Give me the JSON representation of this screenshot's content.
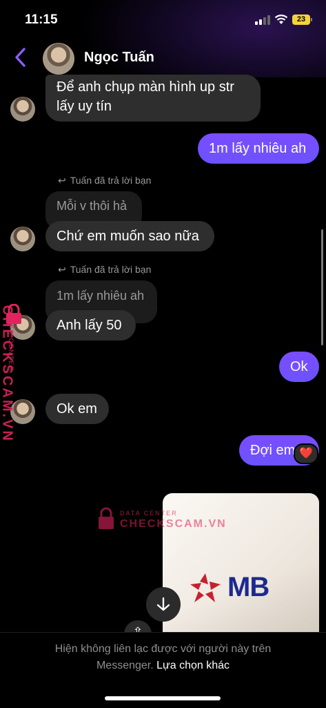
{
  "status_bar": {
    "time": "11:15",
    "battery": "23"
  },
  "header": {
    "contact_name": "Ngọc Tuấn"
  },
  "messages": {
    "m1": "Để anh chụp màn hình up str",
    "m1b": "lấy uy tín",
    "m2": "1m lấy nhiêu ah",
    "reply1_hint": "Tuấn đã trả lời bạn",
    "reply1_quoted": "Mỗi v thôi hả",
    "m3": "Chứ em muốn sao nữa",
    "reply2_hint": "Tuấn đã trả lời bạn",
    "reply2_quoted": "1m lấy nhiêu ah",
    "m4": "Anh lấy 50",
    "m5": "Ok",
    "m6": "Ok em",
    "m7": "Đợi em tí",
    "m7_reaction": "❤️",
    "photo_brand": "MB"
  },
  "footer": {
    "notice": "Hiện không liên lạc được với người này trên",
    "notice_2": "Messenger.",
    "link": "Lựa chọn khác"
  },
  "watermark": {
    "brand": "CHECKSCAM.VN",
    "tagline": "DATA CENTER"
  },
  "colors": {
    "outgoing": "#7c4dff",
    "incoming": "#2e2e2e",
    "accent": "#8c5cff",
    "watermark": "#e0245e"
  }
}
